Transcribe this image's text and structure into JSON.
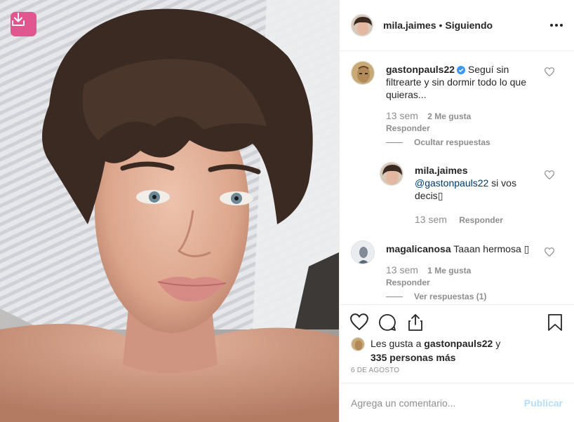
{
  "post": {
    "author": "mila.jaimes",
    "separator": "•",
    "follow_status": "Siguiendo"
  },
  "comments": [
    {
      "user": "gastonpauls22",
      "verified": true,
      "text": "Seguí sin filtrearte y sin dormir todo lo que quieras...",
      "time": "13 sem",
      "likes": "2 Me gusta",
      "reply_label": "Responder",
      "thread_toggle": "Ocultar respuestas",
      "replies": [
        {
          "user": "mila.jaimes",
          "mention": "@gastonpauls22",
          "text": " si vos decis",
          "emoji": "▯",
          "time": "13 sem",
          "reply_label": "Responder"
        }
      ]
    },
    {
      "user": "magalicanosa",
      "text": "Taaan hermosa ",
      "emoji": "▯",
      "time": "13 sem",
      "likes": "1 Me gusta",
      "reply_label": "Responder",
      "thread_toggle": "Ver respuestas (1)"
    }
  ],
  "likes_summary": {
    "prefix": "Les gusta a ",
    "user": "gastonpauls22",
    "middle": " y",
    "count": "335 personas más"
  },
  "date": "6 DE AGOSTO",
  "add_comment": {
    "placeholder": "Agrega un comentario...",
    "publish_label": "Publicar"
  },
  "icons": {
    "download": "download-icon",
    "more": "more-options-icon",
    "heart": "heart-icon",
    "comment": "comment-icon",
    "share": "share-icon",
    "save": "bookmark-icon",
    "verified": "verified-badge-icon"
  },
  "colors": {
    "download_button": "#e0568f",
    "publish_disabled": "#b2dffc",
    "verified": "#3897f0",
    "mention": "#00376b",
    "secondary_text": "#8e8e8e"
  }
}
